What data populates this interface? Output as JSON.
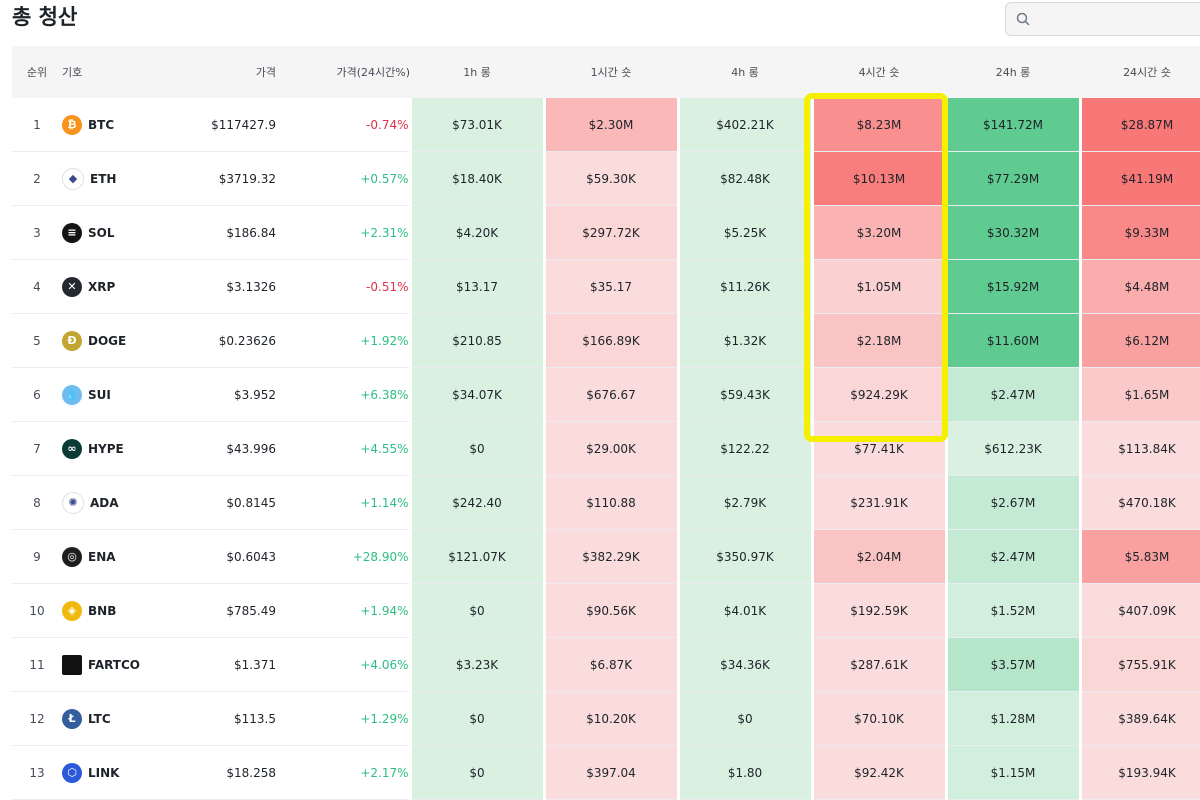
{
  "title": "총 청산",
  "search": {
    "placeholder": ""
  },
  "headers": {
    "rank": "순위",
    "symbol": "기호",
    "price": "가격",
    "change": "가격(24시간%)",
    "h1_long": "1h 롱",
    "h1_short": "1시간 숏",
    "h4_long": "4h 롱",
    "h4_short": "4시간 숏",
    "h24_long": "24h 롱",
    "h24_short": "24시간 숏"
  },
  "colors": {
    "long_base": "#e8f5ec",
    "short_base": "#fbe8e8",
    "long_strong": "#58c98b",
    "short_strong": "#f87171",
    "positive_text": "#2ebd85",
    "negative_text": "#e0324b",
    "highlight": "#f5f000"
  },
  "rows": [
    {
      "rank": "1",
      "symbol": "BTC",
      "icon": "bitcoin-icon",
      "icon_color": "#f7931a",
      "glyph": "₿",
      "price": "$117427.9",
      "change": "-0.74%",
      "dir": "neg",
      "h1_long": "$73.01K",
      "h1_short": "$2.30M",
      "h4_long": "$402.21K",
      "h4_short": "$8.23M",
      "h24_long": "$141.72M",
      "h24_short": "$28.87M",
      "intensity": [
        0.1,
        0.4,
        0.1,
        0.75,
        0.95,
        0.95
      ]
    },
    {
      "rank": "2",
      "symbol": "ETH",
      "icon": "ethereum-icon",
      "icon_color": "#ffffff",
      "glyph": "◆",
      "price": "$3719.32",
      "change": "+0.57%",
      "dir": "pos",
      "h1_long": "$18.40K",
      "h1_short": "$59.30K",
      "h4_long": "$82.48K",
      "h4_short": "$10.13M",
      "h24_long": "$77.29M",
      "h24_short": "$41.19M",
      "intensity": [
        0.1,
        0.1,
        0.1,
        0.9,
        0.95,
        0.95
      ]
    },
    {
      "rank": "3",
      "symbol": "SOL",
      "icon": "solana-icon",
      "icon_color": "#141414",
      "glyph": "≡",
      "price": "$186.84",
      "change": "+2.31%",
      "dir": "pos",
      "h1_long": "$4.20K",
      "h1_short": "$297.72K",
      "h4_long": "$5.25K",
      "h4_short": "$3.20M",
      "h24_long": "$30.32M",
      "h24_short": "$9.33M",
      "intensity": [
        0.1,
        0.15,
        0.1,
        0.45,
        0.95,
        0.8
      ]
    },
    {
      "rank": "4",
      "symbol": "XRP",
      "icon": "xrp-icon",
      "icon_color": "#23292f",
      "glyph": "✕",
      "price": "$3.1326",
      "change": "-0.51%",
      "dir": "neg",
      "h1_long": "$13.17",
      "h1_short": "$35.17",
      "h4_long": "$11.26K",
      "h4_short": "$1.05M",
      "h24_long": "$15.92M",
      "h24_short": "$4.48M",
      "intensity": [
        0.1,
        0.1,
        0.1,
        0.2,
        0.95,
        0.5
      ]
    },
    {
      "rank": "5",
      "symbol": "DOGE",
      "icon": "dogecoin-icon",
      "icon_color": "#c2a633",
      "glyph": "Ð",
      "price": "$0.23626",
      "change": "+1.92%",
      "dir": "pos",
      "h1_long": "$210.85",
      "h1_short": "$166.89K",
      "h4_long": "$1.32K",
      "h4_short": "$2.18M",
      "h24_long": "$11.60M",
      "h24_short": "$6.12M",
      "intensity": [
        0.1,
        0.15,
        0.1,
        0.3,
        0.95,
        0.6
      ]
    },
    {
      "rank": "6",
      "symbol": "SUI",
      "icon": "sui-icon",
      "icon_color": "#6fbcf0",
      "glyph": "💧",
      "price": "$3.952",
      "change": "+6.38%",
      "dir": "pos",
      "h1_long": "$34.07K",
      "h1_short": "$676.67",
      "h4_long": "$59.43K",
      "h4_short": "$924.29K",
      "h24_long": "$2.47M",
      "h24_short": "$1.65M",
      "intensity": [
        0.1,
        0.1,
        0.1,
        0.15,
        0.25,
        0.25
      ]
    },
    {
      "rank": "7",
      "symbol": "HYPE",
      "icon": "hyperliquid-icon",
      "icon_color": "#0b3b36",
      "glyph": "∞",
      "price": "$43.996",
      "change": "+4.55%",
      "dir": "pos",
      "h1_long": "$0",
      "h1_short": "$29.00K",
      "h4_long": "$122.22",
      "h4_short": "$77.41K",
      "h24_long": "$612.23K",
      "h24_short": "$113.84K",
      "intensity": [
        0.1,
        0.1,
        0.1,
        0.1,
        0.1,
        0.1
      ]
    },
    {
      "rank": "8",
      "symbol": "ADA",
      "icon": "cardano-icon",
      "icon_color": "#ffffff",
      "glyph": "✺",
      "price": "$0.8145",
      "change": "+1.14%",
      "dir": "pos",
      "h1_long": "$242.40",
      "h1_short": "$110.88",
      "h4_long": "$2.79K",
      "h4_short": "$231.91K",
      "h24_long": "$2.67M",
      "h24_short": "$470.18K",
      "intensity": [
        0.1,
        0.1,
        0.1,
        0.1,
        0.25,
        0.1
      ]
    },
    {
      "rank": "9",
      "symbol": "ENA",
      "icon": "ethena-icon",
      "icon_color": "#1e1e1e",
      "glyph": "◎",
      "price": "$0.6043",
      "change": "+28.90%",
      "dir": "pos",
      "h1_long": "$121.07K",
      "h1_short": "$382.29K",
      "h4_long": "$350.97K",
      "h4_short": "$2.04M",
      "h24_long": "$2.47M",
      "h24_short": "$5.83M",
      "intensity": [
        0.1,
        0.1,
        0.1,
        0.3,
        0.25,
        0.6
      ]
    },
    {
      "rank": "10",
      "symbol": "BNB",
      "icon": "bnb-icon",
      "icon_color": "#f0b90b",
      "glyph": "◈",
      "price": "$785.49",
      "change": "+1.94%",
      "dir": "pos",
      "h1_long": "$0",
      "h1_short": "$90.56K",
      "h4_long": "$4.01K",
      "h4_short": "$192.59K",
      "h24_long": "$1.52M",
      "h24_short": "$407.09K",
      "intensity": [
        0.1,
        0.1,
        0.1,
        0.1,
        0.15,
        0.1
      ]
    },
    {
      "rank": "11",
      "symbol": "FARTCO",
      "icon": "fartcoin-icon",
      "icon_color": "#111111",
      "glyph": "",
      "price": "$1.371",
      "change": "+4.06%",
      "dir": "pos",
      "h1_long": "$3.23K",
      "h1_short": "$6.87K",
      "h4_long": "$34.36K",
      "h4_short": "$287.61K",
      "h24_long": "$3.57M",
      "h24_short": "$755.91K",
      "intensity": [
        0.1,
        0.1,
        0.1,
        0.1,
        0.35,
        0.15
      ]
    },
    {
      "rank": "12",
      "symbol": "LTC",
      "icon": "litecoin-icon",
      "icon_color": "#345d9d",
      "glyph": "Ł",
      "price": "$113.5",
      "change": "+1.29%",
      "dir": "pos",
      "h1_long": "$0",
      "h1_short": "$10.20K",
      "h4_long": "$0",
      "h4_short": "$70.10K",
      "h24_long": "$1.28M",
      "h24_short": "$389.64K",
      "intensity": [
        0.1,
        0.1,
        0.1,
        0.1,
        0.15,
        0.1
      ]
    },
    {
      "rank": "13",
      "symbol": "LINK",
      "icon": "chainlink-icon",
      "icon_color": "#2a5ada",
      "glyph": "⬡",
      "price": "$18.258",
      "change": "+2.17%",
      "dir": "pos",
      "h1_long": "$0",
      "h1_short": "$397.04",
      "h4_long": "$1.80",
      "h4_short": "$92.42K",
      "h24_long": "$1.15M",
      "h24_short": "$193.94K",
      "intensity": [
        0.1,
        0.1,
        0.1,
        0.1,
        0.15,
        0.1
      ]
    }
  ]
}
